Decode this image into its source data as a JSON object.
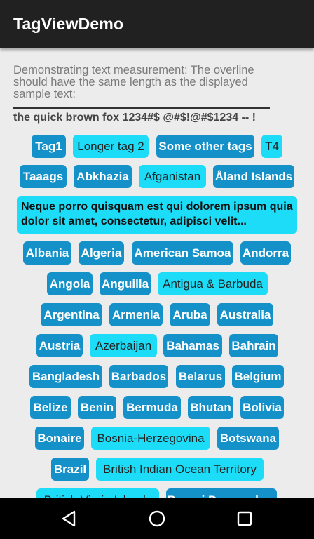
{
  "app": {
    "title": "TagViewDemo"
  },
  "description": "Demonstrating text measurement: The overline should have the same length as the displayed sample text:",
  "sample_text": "the quick brown fox 1234#$ @#$!@#$1234 -- !",
  "tags": [
    {
      "label": "Tag1",
      "style": "dark"
    },
    {
      "label": "Longer tag 2",
      "style": "light"
    },
    {
      "label": "Some other tags",
      "style": "dark"
    },
    {
      "label": "T4",
      "style": "light"
    },
    {
      "label": "Taaags",
      "style": "dark"
    },
    {
      "label": "Abkhazia",
      "style": "dark"
    },
    {
      "label": "Afganistan",
      "style": "light"
    },
    {
      "label": "Åland Islands",
      "style": "dark"
    },
    {
      "label": "Neque porro quisquam est qui dolorem ipsum quia dolor sit amet, consectetur, adipisci velit...",
      "style": "light"
    },
    {
      "label": "Albania",
      "style": "dark"
    },
    {
      "label": "Algeria",
      "style": "dark"
    },
    {
      "label": "American Samoa",
      "style": "dark"
    },
    {
      "label": "Andorra",
      "style": "dark"
    },
    {
      "label": "Angola",
      "style": "dark"
    },
    {
      "label": "Anguilla",
      "style": "dark"
    },
    {
      "label": "Antigua & Barbuda",
      "style": "light"
    },
    {
      "label": "Argentina",
      "style": "dark"
    },
    {
      "label": "Armenia",
      "style": "dark"
    },
    {
      "label": "Aruba",
      "style": "dark"
    },
    {
      "label": "Australia",
      "style": "dark"
    },
    {
      "label": "Austria",
      "style": "dark"
    },
    {
      "label": "Azerbaijan",
      "style": "light"
    },
    {
      "label": "Bahamas",
      "style": "dark"
    },
    {
      "label": "Bahrain",
      "style": "dark"
    },
    {
      "label": "Bangladesh",
      "style": "dark"
    },
    {
      "label": "Barbados",
      "style": "dark"
    },
    {
      "label": "Belarus",
      "style": "dark"
    },
    {
      "label": "Belgium",
      "style": "dark"
    },
    {
      "label": "Belize",
      "style": "dark"
    },
    {
      "label": "Benin",
      "style": "dark"
    },
    {
      "label": "Bermuda",
      "style": "dark"
    },
    {
      "label": "Bhutan",
      "style": "dark"
    },
    {
      "label": "Bolivia",
      "style": "dark"
    },
    {
      "label": "Bonaire",
      "style": "dark"
    },
    {
      "label": "Bosnia-Herzegovina",
      "style": "light"
    },
    {
      "label": "Botswana",
      "style": "dark"
    },
    {
      "label": "Brazil",
      "style": "dark"
    },
    {
      "label": "British Indian Ocean Territory",
      "style": "light"
    },
    {
      "label": "British Virgin Islands",
      "style": "light"
    },
    {
      "label": "Brunei Darussalam",
      "style": "dark"
    }
  ],
  "navigation": {
    "back_icon": "back-icon",
    "home_icon": "home-icon",
    "recents_icon": "recents-icon"
  },
  "colors": {
    "tag_dark": "#1591c9",
    "tag_light": "#1ddcf7",
    "appbar": "#212121",
    "background": "#ececec"
  }
}
